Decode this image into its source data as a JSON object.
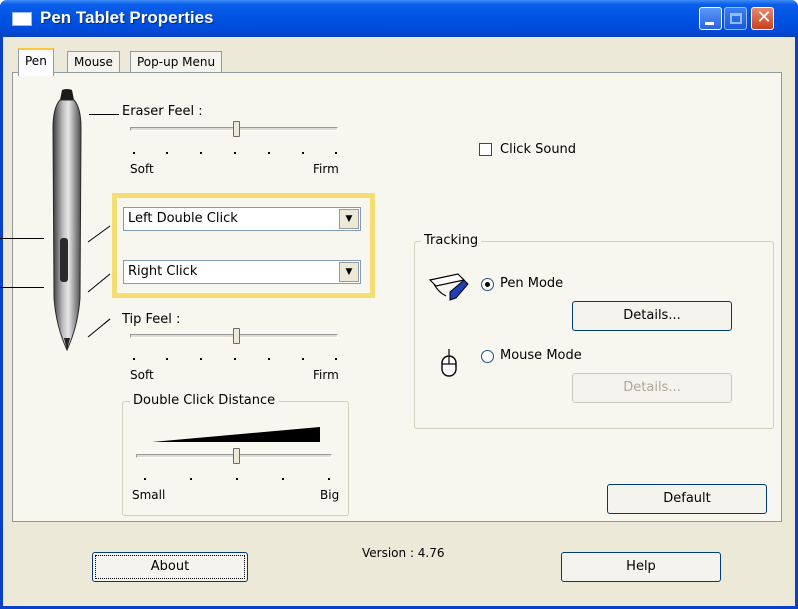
{
  "window": {
    "title": "Pen Tablet Properties"
  },
  "tabs": [
    {
      "label": "Pen",
      "active": true
    },
    {
      "label": "Mouse",
      "active": false
    },
    {
      "label": "Pop-up Menu",
      "active": false
    }
  ],
  "pen": {
    "eraser_feel": {
      "label": "Eraser Feel :",
      "min_label": "Soft",
      "max_label": "Firm",
      "value": 0.5
    },
    "side_switch_upper": {
      "value": "Left Double Click"
    },
    "side_switch_lower": {
      "value": "Right Click"
    },
    "tip_feel": {
      "label": "Tip Feel :",
      "min_label": "Soft",
      "max_label": "Firm",
      "value": 0.5
    },
    "double_click_distance": {
      "label": "Double Click Distance",
      "min_label": "Small",
      "max_label": "Big",
      "value": 0.5
    }
  },
  "click_sound": {
    "label": "Click Sound",
    "checked": false
  },
  "tracking": {
    "label": "Tracking",
    "pen_mode": {
      "label": "Pen Mode",
      "selected": true,
      "details_label": "Details..."
    },
    "mouse_mode": {
      "label": "Mouse Mode",
      "selected": false,
      "details_label": "Details..."
    }
  },
  "default_label": "Default",
  "about_label": "About",
  "version_text": "Version : 4.76",
  "help_label": "Help",
  "colors": {
    "title_bar": "#0053e3",
    "highlight_frame": "#f6dd72",
    "dialog_bg": "#ece9d8"
  }
}
